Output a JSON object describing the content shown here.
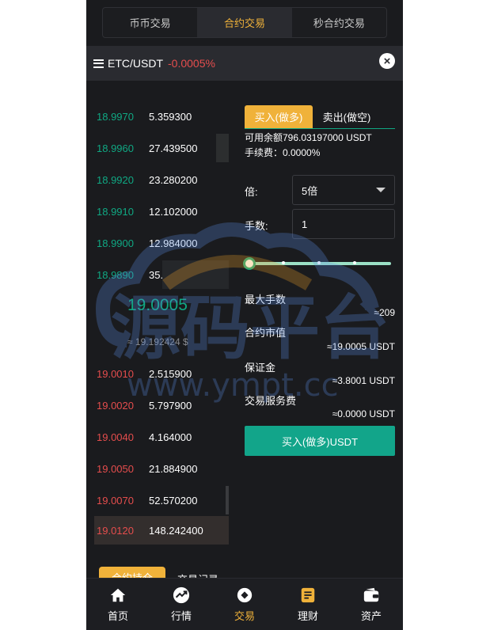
{
  "tabs": [
    "币币交易",
    "合约交易",
    "秒合约交易"
  ],
  "pair": {
    "name": "ETC/USDT",
    "change": "-0.0005%"
  },
  "asks_top": [
    {
      "price": "18.9970",
      "amount": "5.359300"
    },
    {
      "price": "18.9960",
      "amount": "27.439500"
    },
    {
      "price": "18.9920",
      "amount": "23.280200"
    },
    {
      "price": "18.9910",
      "amount": "12.102000"
    },
    {
      "price": "18.9900",
      "amount": "12.984000"
    },
    {
      "price": "18.9890",
      "amount": "35.779200"
    }
  ],
  "last_price": "19.0005",
  "usd_price": "≈ 19.192424 $",
  "bids": [
    {
      "price": "19.0010",
      "amount": "2.515900"
    },
    {
      "price": "19.0020",
      "amount": "5.797900"
    },
    {
      "price": "19.0040",
      "amount": "4.164000"
    },
    {
      "price": "19.0050",
      "amount": "21.884900"
    },
    {
      "price": "19.0070",
      "amount": "52.570200"
    },
    {
      "price": "19.0120",
      "amount": "148.242400"
    }
  ],
  "trade": {
    "buy_tab": "买入(做多)",
    "sell_tab": "卖出(做空)",
    "balance": "可用余额796.03197000 USDT",
    "fee": "手续费：0.0000%",
    "leverage_label": "倍:",
    "leverage_value": "5倍",
    "qty_label": "手数:",
    "qty_value": "1",
    "max_qty_label": "最大手数",
    "max_qty_value": "≈209",
    "contract_value_label": "合约市值",
    "contract_value": "≈19.0005 USDT",
    "margin_label": "保证金",
    "margin_value": "≈3.8001 USDT",
    "service_fee_label": "交易服务费",
    "service_fee_value": "≈0.0000 USDT",
    "buy_button": "买入(做多)USDT"
  },
  "bottom_tabs": [
    "合约持仓",
    "交易记录"
  ],
  "nav": [
    "首页",
    "行情",
    "交易",
    "理财",
    "资产"
  ],
  "watermark": {
    "text": "源码平台",
    "url": "www.ympt.cc"
  },
  "colors": {
    "accent": "#f0b23a",
    "green": "#10a883",
    "red": "#e54d4d",
    "bg": "#1a1b1e"
  }
}
